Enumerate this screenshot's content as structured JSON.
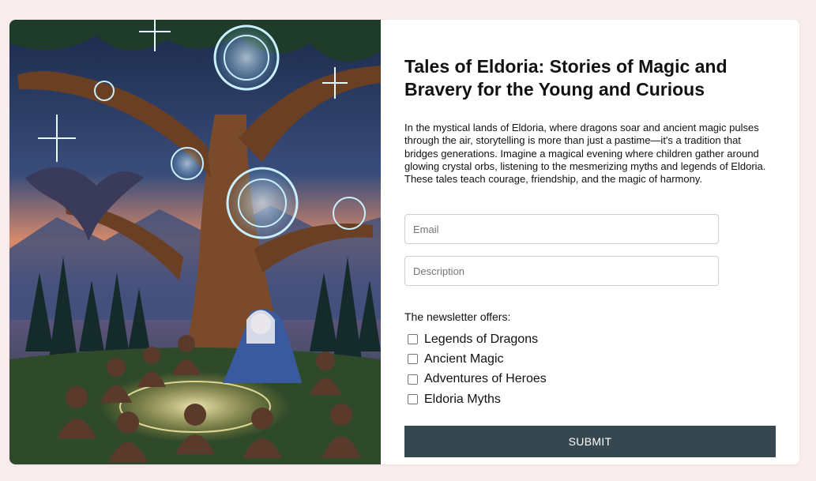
{
  "article": {
    "title": "Tales of Eldoria: Stories of Magic and Bravery for the Young and Curious",
    "intro": "In the mystical lands of Eldoria, where dragons soar and ancient magic pulses through the air, storytelling is more than just a pastime—it's a tradition that bridges generations. Imagine a magical evening where children gather around glowing crystal orbs, listening to the mesmerizing myths and legends of Eldoria. These tales teach courage, friendship, and the magic of harmony."
  },
  "form": {
    "email_placeholder": "Email",
    "description_placeholder": "Description",
    "offers_label": "The newsletter offers:",
    "options": [
      {
        "label": "Legends of Dragons",
        "checked": false
      },
      {
        "label": "Ancient Magic",
        "checked": false
      },
      {
        "label": "Adventures of Heroes",
        "checked": false
      },
      {
        "label": "Eldoria Myths",
        "checked": false
      }
    ],
    "submit_label": "SUBMIT"
  },
  "colors": {
    "page_background": "#f9ecec",
    "card_background": "#ffffff",
    "button_background": "#37474f",
    "button_text": "#ffffff"
  },
  "image": {
    "icon": "storyteller-tree-illustration"
  }
}
